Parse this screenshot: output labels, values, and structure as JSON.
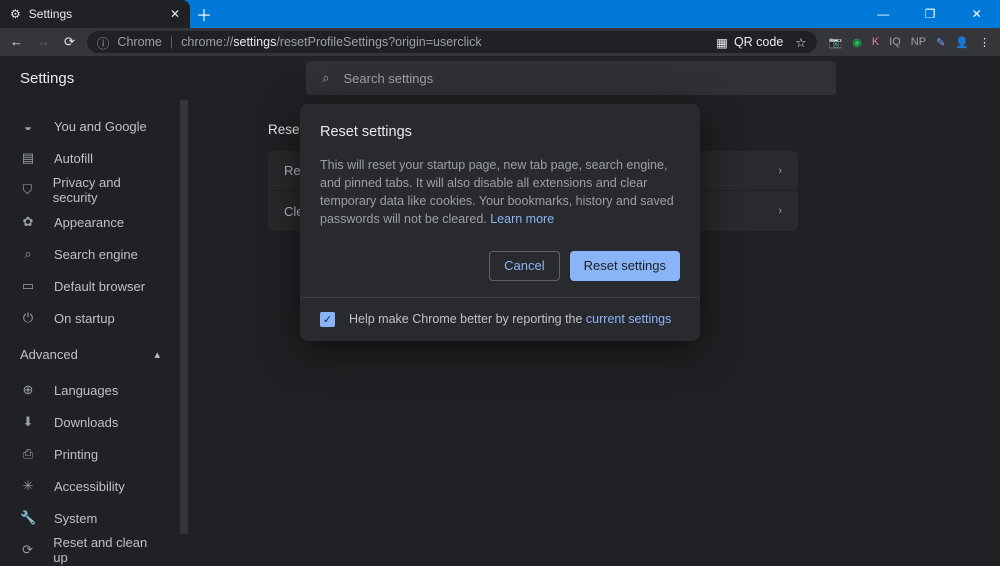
{
  "window": {
    "tab_title": "Settings"
  },
  "omnibox": {
    "security_label": "Chrome",
    "url_prefix": "chrome://",
    "url_highlight": "settings",
    "url_rest": "/resetProfileSettings?origin=userclick",
    "qr_label": "QR code"
  },
  "header": {
    "title": "Settings",
    "search_placeholder": "Search settings"
  },
  "sidebar": {
    "items": [
      {
        "icon": "person-icon",
        "glyph": "◒",
        "label": "You and Google"
      },
      {
        "icon": "autofill-icon",
        "glyph": "▤",
        "label": "Autofill"
      },
      {
        "icon": "shield-icon",
        "glyph": "⛉",
        "label": "Privacy and security"
      },
      {
        "icon": "appearance-icon",
        "glyph": "✿",
        "label": "Appearance"
      },
      {
        "icon": "search-icon",
        "glyph": "⌕",
        "label": "Search engine"
      },
      {
        "icon": "browser-icon",
        "glyph": "▭",
        "label": "Default browser"
      },
      {
        "icon": "power-icon",
        "glyph": "⏻",
        "label": "On startup"
      }
    ],
    "advanced_label": "Advanced",
    "adv_items": [
      {
        "icon": "globe-icon",
        "glyph": "⊕",
        "label": "Languages"
      },
      {
        "icon": "download-icon",
        "glyph": "⬇",
        "label": "Downloads"
      },
      {
        "icon": "print-icon",
        "glyph": "⎙",
        "label": "Printing"
      },
      {
        "icon": "accessibility-icon",
        "glyph": "✳",
        "label": "Accessibility"
      },
      {
        "icon": "system-icon",
        "glyph": "🔧",
        "label": "System"
      },
      {
        "icon": "reset-icon",
        "glyph": "⟳",
        "label": "Reset and clean up"
      }
    ]
  },
  "main": {
    "section_title": "Reset and clean up",
    "rows": [
      "Restore settings to their original defaults",
      "Clean up computer"
    ]
  },
  "dialog": {
    "title": "Reset settings",
    "body": "This will reset your startup page, new tab page, search engine, and pinned tabs. It will also disable all extensions and clear temporary data like cookies. Your bookmarks, history and saved passwords will not be cleared.",
    "learn_more": "Learn more",
    "cancel": "Cancel",
    "confirm": "Reset settings",
    "footer_text": "Help make Chrome better by reporting the ",
    "footer_link": "current settings",
    "checkbox_checked": true
  }
}
